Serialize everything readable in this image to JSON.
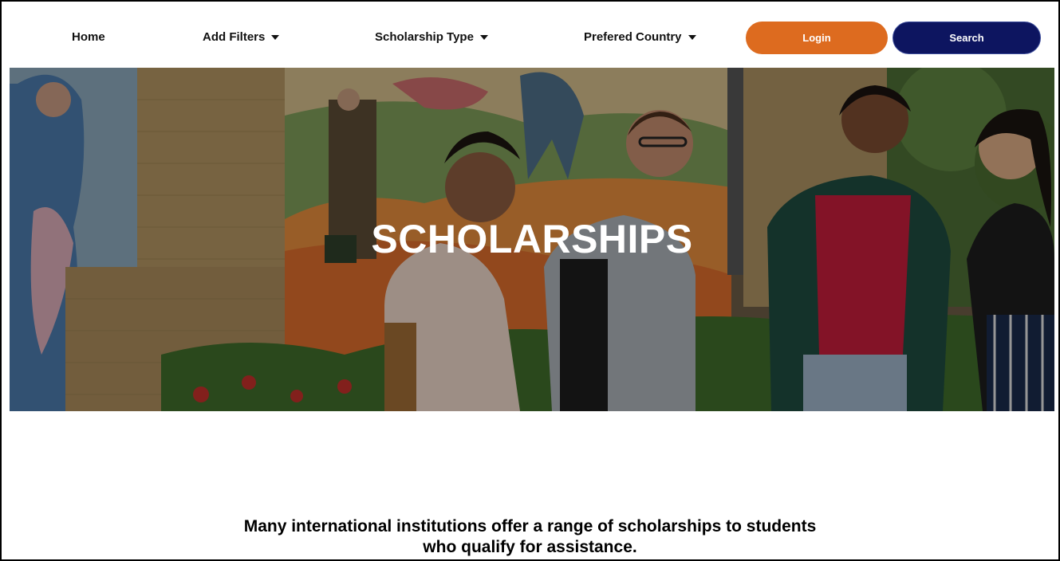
{
  "nav": {
    "home_label": "Home",
    "filters_label": "Add Filters",
    "scholarship_type_label": "Scholarship Type",
    "country_label": "Prefered Country",
    "login_label": "Login",
    "search_label": "Search"
  },
  "colors": {
    "login_button": "#dd6b1f",
    "search_button": "#0d1560"
  },
  "hero": {
    "title": "SCHOLARSHIPS"
  },
  "intro": {
    "line1": "Many international institutions offer a range of scholarships to students",
    "line2": "who qualify for assistance."
  }
}
